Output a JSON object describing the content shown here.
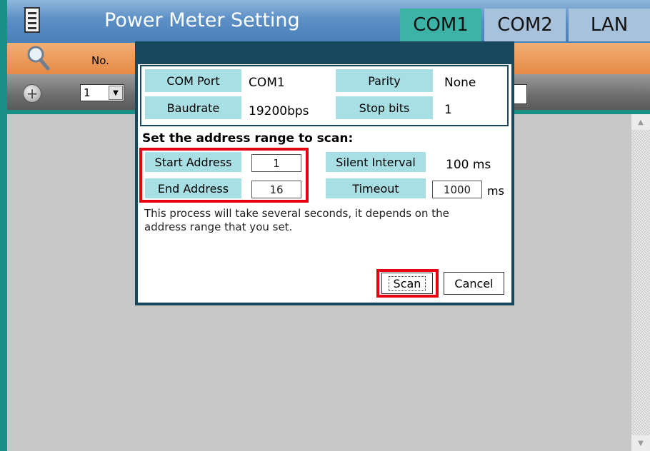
{
  "app": {
    "title": "Power Meter Setting",
    "tabs": [
      {
        "label": "COM1",
        "active": true
      },
      {
        "label": "COM2",
        "active": false
      },
      {
        "label": "LAN",
        "active": false
      }
    ]
  },
  "table": {
    "header_no": "No.",
    "selected_no": "1"
  },
  "dialog": {
    "com_port_label": "COM Port",
    "com_port_value": "COM1",
    "parity_label": "Parity",
    "parity_value": "None",
    "baudrate_label": "Baudrate",
    "baudrate_value": "19200bps",
    "stop_bits_label": "Stop bits",
    "stop_bits_value": "1",
    "scan_heading": "Set the address range to scan:",
    "start_address_label": "Start Address",
    "start_address_value": "1",
    "end_address_label": "End Address",
    "end_address_value": "16",
    "silent_interval_label": "Silent Interval",
    "silent_interval_value": "100 ms",
    "timeout_label": "Timeout",
    "timeout_value": "1000",
    "timeout_unit": "ms",
    "info_text": "This process will take several seconds, it depends on the address range that you set.",
    "scan_button": "Scan",
    "cancel_button": "Cancel"
  },
  "colors": {
    "title_bar": "#5b8fc5",
    "active_tab": "#3cb3a6",
    "header_orange": "#e68a45",
    "dialog_border": "#17485e",
    "label_bg": "#a8dfe4",
    "highlight_red": "#e60012"
  },
  "icons": {
    "menu": "menu-icon",
    "search": "search-icon",
    "add": "add-icon"
  }
}
